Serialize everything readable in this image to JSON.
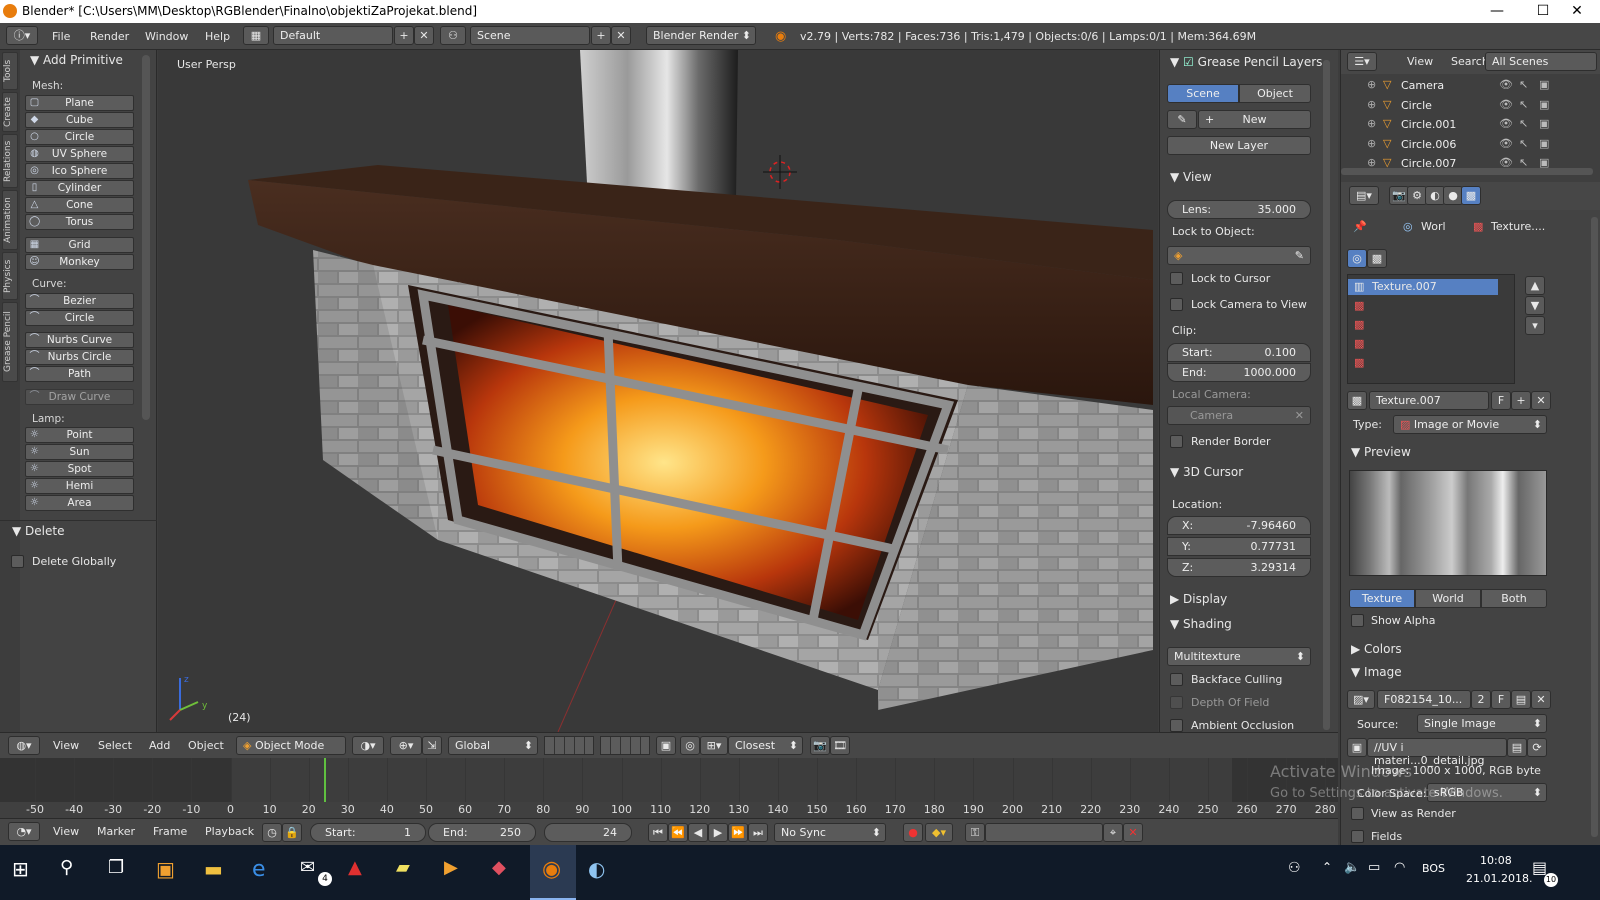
{
  "window": {
    "title": "Blender* [C:\\Users\\MM\\Desktop\\RGBlender\\Finalno\\objektiZaProjekat.blend]",
    "minimize": "—",
    "maximize": "☐",
    "close": "✕"
  },
  "infobar": {
    "menus": [
      "File",
      "Render",
      "Window",
      "Help"
    ],
    "layout": "Default",
    "scene": "Scene",
    "engine": "Blender Render",
    "stats": "v2.79 | Verts:782 | Faces:736 | Tris:1,479 | Objects:0/6 | Lamps:0/1 | Mem:364.69M"
  },
  "toolshelf": {
    "tabs": [
      "Tools",
      "Create",
      "Relations",
      "Animation",
      "Physics",
      "Grease Pencil"
    ],
    "panel_title": "Add Primitive",
    "mesh_label": "Mesh:",
    "mesh": [
      "Plane",
      "Cube",
      "Circle",
      "UV Sphere",
      "Ico Sphere",
      "Cylinder",
      "Cone",
      "Torus",
      "Grid",
      "Monkey"
    ],
    "curve_label": "Curve:",
    "curve": [
      "Bezier",
      "Circle",
      "Nurbs Curve",
      "Nurbs Circle",
      "Path",
      "Draw Curve"
    ],
    "lamp_label": "Lamp:",
    "lamp": [
      "Point",
      "Sun",
      "Spot",
      "Hemi",
      "Area"
    ],
    "delete_title": "Delete",
    "delete_globally": "Delete Globally"
  },
  "viewport": {
    "label": "User Persp",
    "frame": "(24)"
  },
  "npanel": {
    "gp_title": "Grease Pencil Layers",
    "gp_scene": "Scene",
    "gp_object": "Object",
    "gp_new": "New",
    "gp_new_layer": "New Layer",
    "view_title": "View",
    "lens_label": "Lens:",
    "lens": "35.000",
    "lock_to_object": "Lock to Object:",
    "lock_to_cursor": "Lock to Cursor",
    "lock_camera": "Lock Camera to View",
    "clip": "Clip:",
    "start_label": "Start:",
    "start": "0.100",
    "end_label": "End:",
    "end": "1000.000",
    "local_camera": "Local Camera:",
    "camera": "Camera",
    "render_border": "Render Border",
    "cursor_title": "3D Cursor",
    "location": "Location:",
    "x_label": "X:",
    "x": "-7.96460",
    "y_label": "Y:",
    "y": "0.77731",
    "z_label": "Z:",
    "z": "3.29314",
    "display_title": "Display",
    "shading_title": "Shading",
    "shading_mode": "Multitexture",
    "backface": "Backface Culling",
    "dof": "Depth Of Field",
    "ao": "Ambient Occlusion"
  },
  "outliner": {
    "view": "View",
    "search": "Search",
    "filter": "All Scenes",
    "items": [
      "Camera",
      "Circle",
      "Circle.001",
      "Circle.006",
      "Circle.007"
    ]
  },
  "properties": {
    "breadcrumb_world": "Worl",
    "breadcrumb_texture": "Texture....",
    "slot_selected": "Texture.007",
    "texture_name": "Texture.007",
    "texture_f": "F",
    "type_label": "Type:",
    "type_value": "Image or Movie",
    "preview_title": "Preview",
    "tab_texture": "Texture",
    "tab_world": "World",
    "tab_both": "Both",
    "show_alpha": "Show Alpha",
    "colors_title": "Colors",
    "image_title": "Image",
    "image_name": "F082154_10...",
    "image_users": "2",
    "image_f": "F",
    "source_label": "Source:",
    "source_value": "Single Image",
    "filepath": "//UV i materi...0_detail.jpg",
    "image_info": "Image: 1000 x 1000, RGB byte",
    "color_space_label": "Color Space:",
    "color_space": "sRGB",
    "view_as_render": "View as Render",
    "fields": "Fields"
  },
  "vheader": {
    "menus": [
      "View",
      "Select",
      "Add",
      "Object"
    ],
    "mode": "Object Mode",
    "orientation": "Global",
    "snap": "Closest"
  },
  "timeline": {
    "ticks": [
      "-50",
      "-40",
      "-30",
      "-20",
      "-10",
      "0",
      "10",
      "20",
      "30",
      "40",
      "50",
      "60",
      "70",
      "80",
      "90",
      "100",
      "110",
      "120",
      "130",
      "140",
      "150",
      "160",
      "170",
      "180",
      "190",
      "200",
      "210",
      "220",
      "230",
      "240",
      "250",
      "260",
      "270",
      "280"
    ],
    "current_frame": 24
  },
  "theader": {
    "menus": [
      "View",
      "Marker",
      "Frame",
      "Playback"
    ],
    "start_label": "Start:",
    "start": "1",
    "end_label": "End:",
    "end": "250",
    "frame": "24",
    "sync": "No Sync"
  },
  "taskbar": {
    "mail_badge": "4",
    "lang": "BOS",
    "time": "10:08",
    "date": "21.01.2018.",
    "notif": "10"
  },
  "watermark": {
    "line1": "Activate Windows",
    "line2": "Go to Settings to activate Windows."
  }
}
